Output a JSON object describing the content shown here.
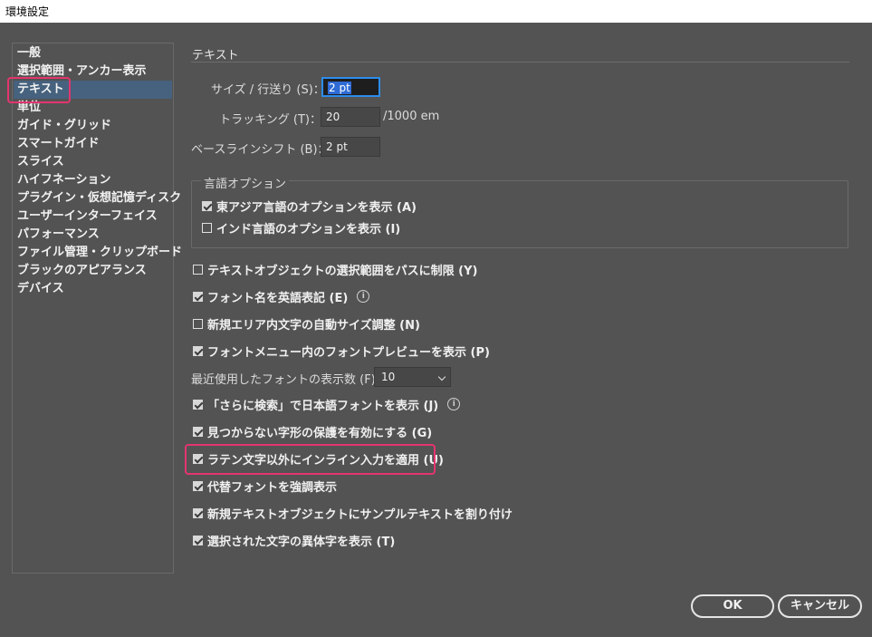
{
  "window": {
    "title": "環境設定"
  },
  "sidebar": {
    "items": [
      {
        "label": "一般"
      },
      {
        "label": "選択範囲・アンカー表示"
      },
      {
        "label": "テキスト"
      },
      {
        "label": "単位"
      },
      {
        "label": "ガイド・グリッド"
      },
      {
        "label": "スマートガイド"
      },
      {
        "label": "スライス"
      },
      {
        "label": "ハイフネーション"
      },
      {
        "label": "プラグイン・仮想記憶ディスク"
      },
      {
        "label": "ユーザーインターフェイス"
      },
      {
        "label": "パフォーマンス"
      },
      {
        "label": "ファイル管理・クリップボード"
      },
      {
        "label": "ブラックのアピアランス"
      },
      {
        "label": "デバイス"
      }
    ],
    "selected": "テキスト"
  },
  "panel": {
    "section_title": "テキスト",
    "size_leading": {
      "label": "サイズ / 行送り (S)：",
      "value": "2 pt"
    },
    "tracking": {
      "label": "トラッキング (T)：",
      "value": "20",
      "unit": "/1000 em"
    },
    "baseline_shift": {
      "label": "ベースラインシフト (B)：",
      "value": "2 pt"
    },
    "language_options": {
      "title": "言語オプション",
      "east_asian": {
        "label": "東アジア言語のオプションを表示 (A)",
        "checked": true
      },
      "indic": {
        "label": "インド言語のオプションを表示 (I)",
        "checked": false
      }
    },
    "checks": {
      "path_select": {
        "label": "テキストオブジェクトの選択範囲をパスに制限 (Y)",
        "checked": false
      },
      "font_english": {
        "label": "フォント名を英語表記 (E)",
        "checked": true
      },
      "auto_size": {
        "label": "新規エリア内文字の自動サイズ調整 (N)",
        "checked": false
      },
      "font_preview": {
        "label": "フォントメニュー内のフォントプレビューを表示 (P)",
        "checked": true
      },
      "more_search": {
        "label": "「さらに検索」で日本語フォントを表示 (J)",
        "checked": true
      },
      "missing_glyph": {
        "label": "見つからない字形の保護を有効にする (G)",
        "checked": true
      },
      "inline_input": {
        "label": "ラテン文字以外にインライン入力を適用 (U)",
        "checked": true
      },
      "highlight_substituted": {
        "label": "代替フォントを強調表示",
        "checked": true
      },
      "fill_placeholder": {
        "label": "新規テキストオブジェクトにサンプルテキストを割り付け",
        "checked": true
      },
      "alternate_glyphs": {
        "label": "選択された文字の異体字を表示 (T)",
        "checked": true
      }
    },
    "recent_fonts": {
      "label": "最近使用したフォントの表示数 (F)：",
      "value": "10"
    },
    "info_icon": "i"
  },
  "buttons": {
    "ok": "OK",
    "cancel": "キャンセル"
  },
  "colors": {
    "background": "#535353",
    "selection": "#46627e",
    "highlight": "#e3356e",
    "focus": "#2d8ceb"
  }
}
